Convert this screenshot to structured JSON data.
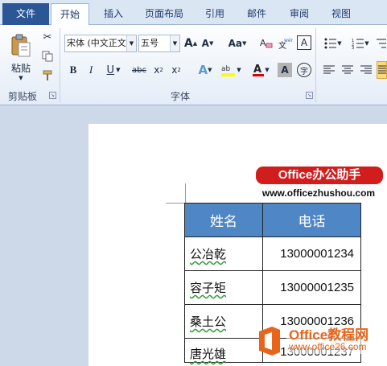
{
  "tabs": [
    {
      "label": "文件"
    },
    {
      "label": "开始"
    },
    {
      "label": "插入"
    },
    {
      "label": "页面布局"
    },
    {
      "label": "引用"
    },
    {
      "label": "邮件"
    },
    {
      "label": "审阅"
    },
    {
      "label": "视图"
    }
  ],
  "ribbon": {
    "clipboard": {
      "paste_label": "粘贴",
      "group_label": "剪贴板"
    },
    "font": {
      "font_name": "宋体 (中文正文",
      "font_size": "五号",
      "group_label": "字体"
    }
  },
  "colors": {
    "file_tab": "#2b5797",
    "table_header": "#4f86c6",
    "brand": "#d21d1d",
    "watermark": "#e8641a"
  },
  "document": {
    "brand_title": "Office办公助手",
    "brand_url": "www.officezhushou.com",
    "table": {
      "headers": [
        "姓名",
        "电话"
      ],
      "rows": [
        {
          "name": "公冶乾",
          "phone": "13000001234"
        },
        {
          "name": "容子矩",
          "phone": "13000001235"
        },
        {
          "name": "桑土公",
          "phone": "13000001236"
        },
        {
          "name": "唐光雄",
          "phone": "13000001237"
        }
      ]
    }
  },
  "watermark": {
    "title": "Office教程网",
    "url": "www.office26.com"
  }
}
